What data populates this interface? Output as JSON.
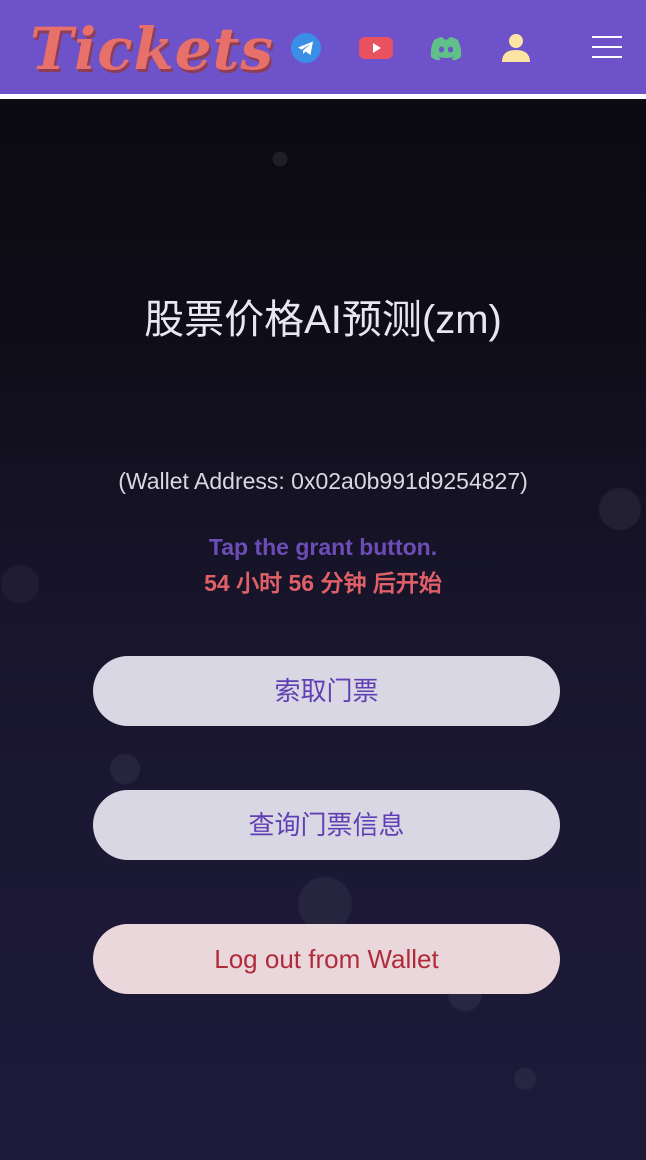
{
  "header": {
    "logo_text": "Tickets",
    "icons": [
      "telegram-icon",
      "youtube-icon",
      "discord-icon",
      "user-icon",
      "menu-icon"
    ]
  },
  "main": {
    "title": "股票价格AI预测(zm)",
    "wallet_text": "(Wallet Address: 0x02a0b991d9254827)",
    "instruction": "Tap the grant button.",
    "countdown": "54 小时 56 分钟 后开始",
    "buttons": {
      "claim": "索取门票",
      "query": "查询门票信息",
      "logout": "Log out from Wallet"
    }
  },
  "colors": {
    "header_bg": "#6e52c9",
    "logo": "#e8706a",
    "instruction": "#6b4db6",
    "countdown": "#e06068",
    "button_text": "#5f3fb4",
    "logout_text": "#b12c3a"
  }
}
